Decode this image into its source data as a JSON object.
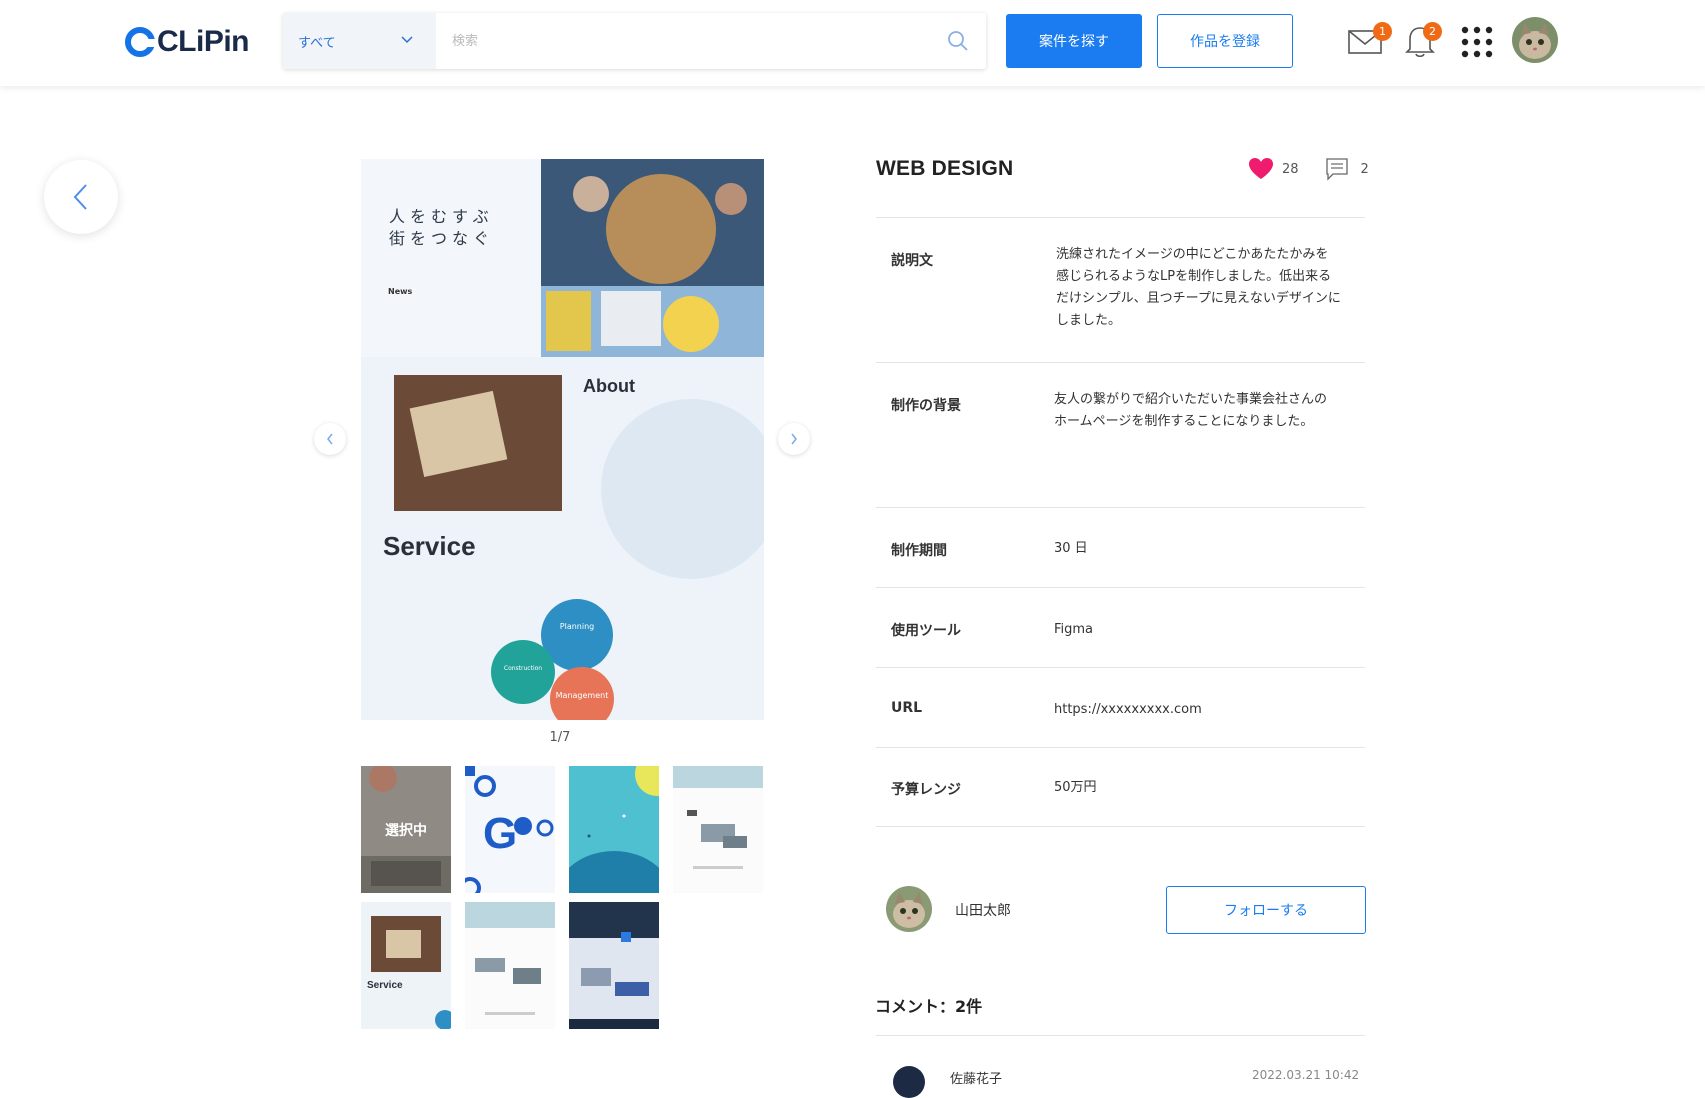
{
  "header": {
    "logo_text": "CLiPin",
    "search_category": "すべて",
    "search_placeholder": "検索",
    "find_jobs_label": "案件を探す",
    "register_work_label": "作品を登録",
    "mail_badge": "1",
    "notification_badge": "2"
  },
  "gallery": {
    "counter": "1/7",
    "selected_label": "選択中",
    "main_image": {
      "headline_line1": "人をむすぶ",
      "headline_line2": "街をつなぐ",
      "news_label": "News",
      "about_label": "About",
      "service_label": "Service",
      "bubble_1": "Planning",
      "bubble_2": "Construction",
      "bubble_3": "Management"
    },
    "thumb_service_label": "Service"
  },
  "work": {
    "title": "WEB DESIGN",
    "likes": "28",
    "comments": "2",
    "details": [
      {
        "label": "説明文",
        "value": "洗練されたイメージの中にどこかあたたかみを感じられるようなLPを制作しました。低出来るだけシンプル、且つチープに見えないデザインにしました。"
      },
      {
        "label": "制作の背景",
        "value": "友人の繋がりで紹介いただいた事業会社さんのホームページを制作することになりました。"
      },
      {
        "label": "制作期間",
        "value": "30 日"
      },
      {
        "label": "使用ツール",
        "value": "Figma"
      },
      {
        "label": "URL",
        "value": "https://xxxxxxxxx.com"
      },
      {
        "label": "予算レンジ",
        "value": "50万円"
      }
    ]
  },
  "author": {
    "name": "山田太郎",
    "follow_label": "フォローする"
  },
  "comments_section": {
    "heading": "コメント：2件",
    "first_comment_name": "佐藤花子",
    "first_comment_date": "2022.03.21 10:42"
  },
  "colors": {
    "accent": "#1a7cf0",
    "badge": "#f06a16",
    "like": "#ee1b6e"
  }
}
